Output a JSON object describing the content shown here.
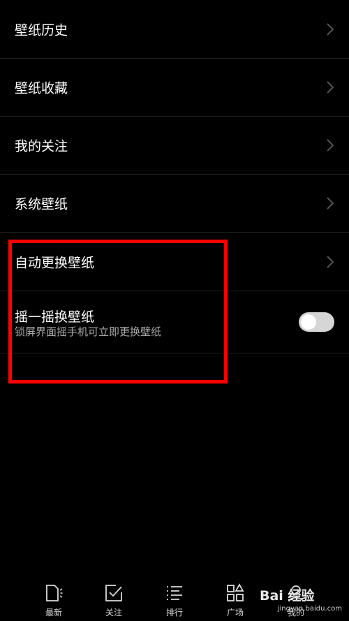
{
  "menu": {
    "items": [
      {
        "label": "壁纸历史"
      },
      {
        "label": "壁纸收藏"
      },
      {
        "label": "我的关注"
      },
      {
        "label": "系统壁纸"
      },
      {
        "label": "自动更换壁纸"
      }
    ],
    "shake": {
      "title": "摇一摇换壁纸",
      "subtitle": "锁屏界面摇手机可立即更换壁纸",
      "enabled": false
    }
  },
  "tabs": [
    {
      "label": "最新",
      "icon": "document-icon"
    },
    {
      "label": "关注",
      "icon": "checkbox-icon"
    },
    {
      "label": "排行",
      "icon": "list-icon"
    },
    {
      "label": "广场",
      "icon": "grid-icon"
    },
    {
      "label": "我的",
      "icon": "person-icon"
    }
  ],
  "watermark": {
    "brand": "Bai 经验",
    "url": "jingyan.baidu.com"
  },
  "colors": {
    "background": "#000000",
    "highlight": "#ff0000",
    "toggle_off": "#d6d6d6"
  }
}
